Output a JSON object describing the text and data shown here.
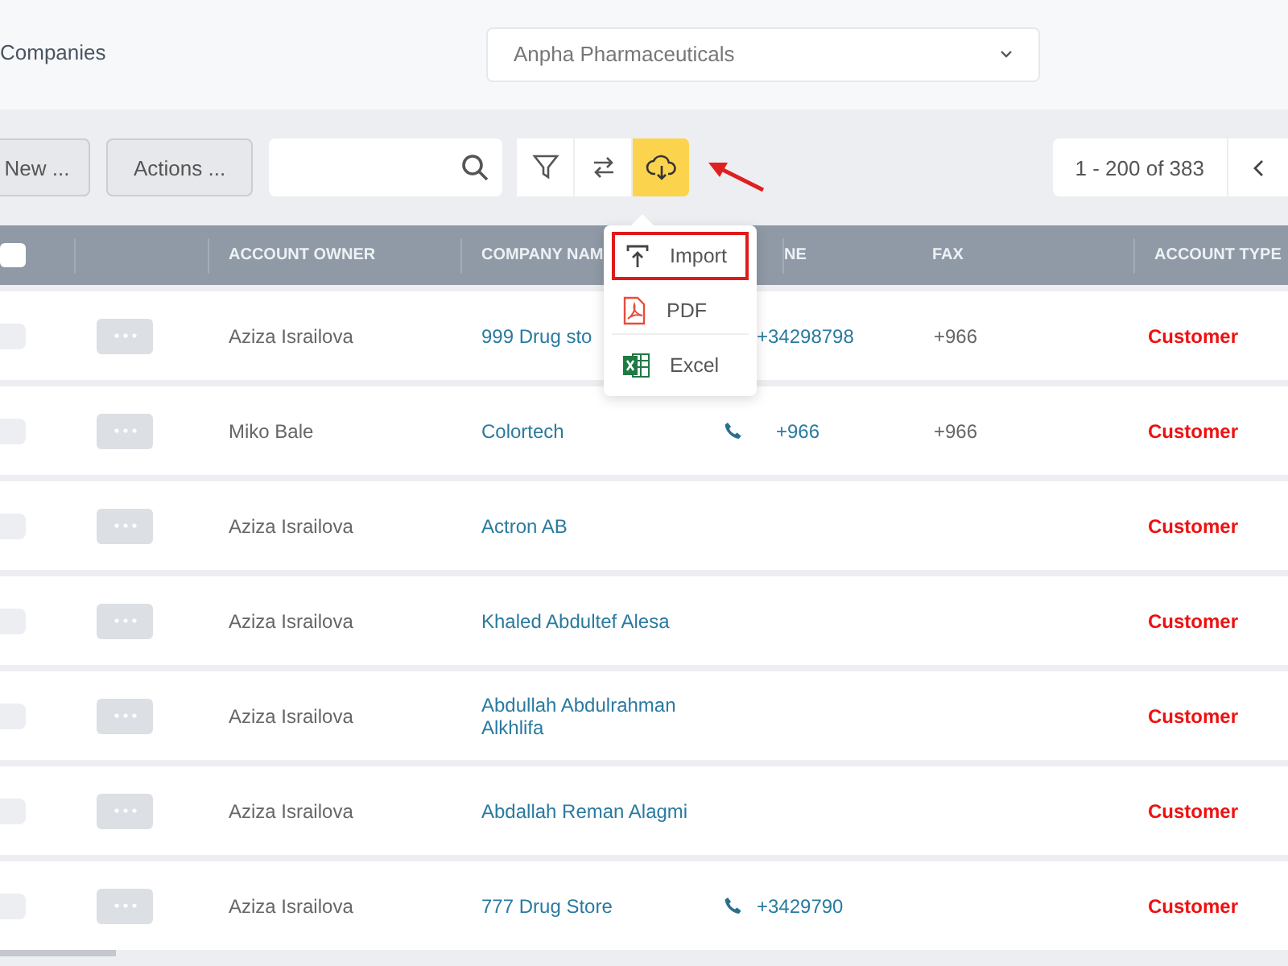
{
  "header": {
    "title": "Companies",
    "company_select": {
      "value": "Anpha Pharmaceuticals"
    }
  },
  "toolbar": {
    "new_button": "New ...",
    "actions_button": "Actions ...",
    "tools": [
      {
        "kind": "filter",
        "selected": false
      },
      {
        "kind": "swap",
        "selected": false
      },
      {
        "kind": "download",
        "selected": true
      }
    ],
    "pager": "1 - 200 of 383"
  },
  "export_menu": {
    "items": [
      {
        "kind": "import",
        "label": "Import",
        "highlighted": true
      },
      {
        "kind": "pdf",
        "label": "PDF",
        "highlighted": false
      },
      {
        "kind": "excel",
        "label": "Excel",
        "highlighted": false
      }
    ]
  },
  "table": {
    "select_all": {
      "checked": false
    },
    "columns": [
      "ACCOUNT OWNER",
      "COMPANY NAM",
      "NE",
      "FAX",
      "ACCOUNT TYPE"
    ],
    "rows": [
      {
        "checked": false,
        "owner": "Aziza Israilova",
        "company": "999 Drug sto",
        "phone": "+34298798",
        "fax": "+966",
        "type": "Customer"
      },
      {
        "checked": false,
        "owner": "Miko Bale",
        "company": "Colortech",
        "phone": "+966",
        "call_icon": true,
        "fax": "+966",
        "type": "Customer"
      },
      {
        "checked": false,
        "owner": "Aziza Israilova",
        "company": "Actron AB",
        "call_icon": false,
        "type": "Customer"
      },
      {
        "checked": false,
        "owner": "Aziza Israilova",
        "company": "Khaled Abdultef Alesa",
        "call_icon": false,
        "type": "Customer"
      },
      {
        "checked": false,
        "owner": "Aziza Israilova",
        "company": "Abdullah Abdulrahman Alkhlifa",
        "call_icon": false,
        "type": "Customer"
      },
      {
        "checked": false,
        "owner": "Aziza Israilova",
        "company": "Abdallah Reman Alagmi",
        "call_icon": false,
        "type": "Customer"
      },
      {
        "checked": false,
        "owner": "Aziza Israilova",
        "company": "777 Drug Store",
        "phone": "+3429790",
        "call_icon": true,
        "type": "Customer"
      }
    ]
  }
}
